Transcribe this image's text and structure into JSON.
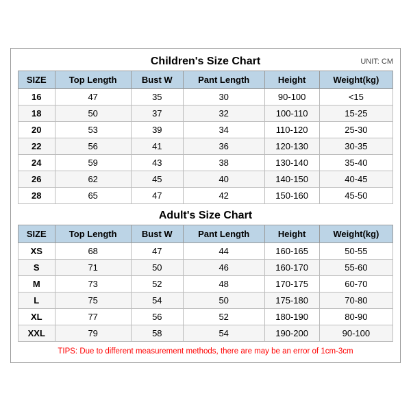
{
  "children_title": "Children's Size Chart",
  "adults_title": "Adult's Size Chart",
  "unit_label": "UNIT: CM",
  "headers": [
    "SIZE",
    "Top Length",
    "Bust W",
    "Pant Length",
    "Height",
    "Weight(kg)"
  ],
  "children_rows": [
    [
      "16",
      "47",
      "35",
      "30",
      "90-100",
      "<15"
    ],
    [
      "18",
      "50",
      "37",
      "32",
      "100-110",
      "15-25"
    ],
    [
      "20",
      "53",
      "39",
      "34",
      "110-120",
      "25-30"
    ],
    [
      "22",
      "56",
      "41",
      "36",
      "120-130",
      "30-35"
    ],
    [
      "24",
      "59",
      "43",
      "38",
      "130-140",
      "35-40"
    ],
    [
      "26",
      "62",
      "45",
      "40",
      "140-150",
      "40-45"
    ],
    [
      "28",
      "65",
      "47",
      "42",
      "150-160",
      "45-50"
    ]
  ],
  "adults_rows": [
    [
      "XS",
      "68",
      "47",
      "44",
      "160-165",
      "50-55"
    ],
    [
      "S",
      "71",
      "50",
      "46",
      "160-170",
      "55-60"
    ],
    [
      "M",
      "73",
      "52",
      "48",
      "170-175",
      "60-70"
    ],
    [
      "L",
      "75",
      "54",
      "50",
      "175-180",
      "70-80"
    ],
    [
      "XL",
      "77",
      "56",
      "52",
      "180-190",
      "80-90"
    ],
    [
      "XXL",
      "79",
      "58",
      "54",
      "190-200",
      "90-100"
    ]
  ],
  "tips": "TIPS: Due to different measurement methods, there are may be an error of 1cm-3cm"
}
